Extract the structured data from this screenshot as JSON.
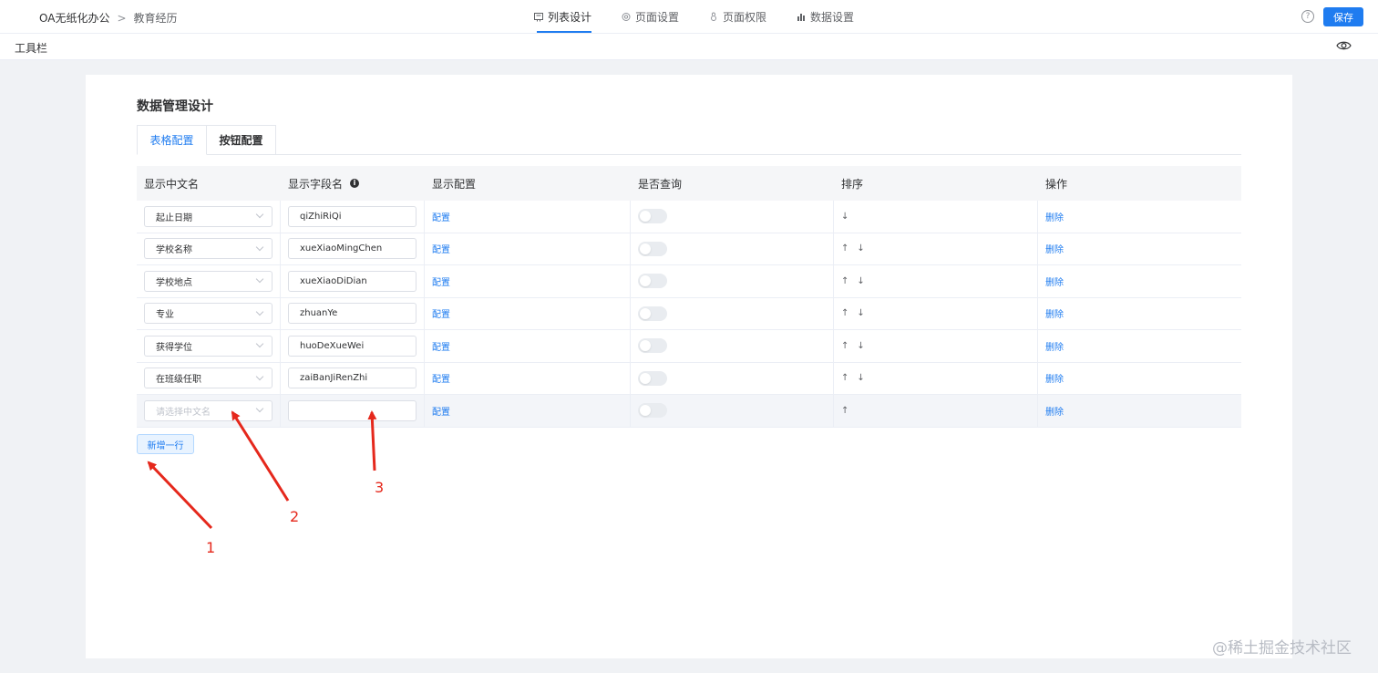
{
  "header": {
    "app_name": "OA无纸化办公",
    "breadcrumb_separator": ">",
    "current_page": "教育经历",
    "tabs": [
      {
        "label": "列表设计",
        "icon": "list-icon",
        "active": true
      },
      {
        "label": "页面设置",
        "icon": "gear-icon",
        "active": false
      },
      {
        "label": "页面权限",
        "icon": "lock-icon",
        "active": false
      },
      {
        "label": "数据设置",
        "icon": "bar-chart-icon",
        "active": false
      }
    ],
    "help_label": "?",
    "save_label": "保存"
  },
  "toolbar": {
    "title": "工具栏"
  },
  "main": {
    "title": "数据管理设计",
    "tabs": [
      {
        "label": "表格配置",
        "active": true
      },
      {
        "label": "按钮配置",
        "active": false
      }
    ],
    "table": {
      "columns": [
        "显示中文名",
        "显示字段名",
        "显示配置",
        "是否查询",
        "排序",
        "操作"
      ],
      "info_label": "i",
      "rows": [
        {
          "chinese_name": "起止日期",
          "field_name": "qiZhiRiQi",
          "config": "配置",
          "query": false,
          "sort_up": "",
          "sort_down": "↓",
          "action": "删除"
        },
        {
          "chinese_name": "学校名称",
          "field_name": "xueXiaoMingChen",
          "config": "配置",
          "query": false,
          "sort_up": "↑",
          "sort_down": "↓",
          "action": "删除"
        },
        {
          "chinese_name": "学校地点",
          "field_name": "xueXiaoDiDian",
          "config": "配置",
          "query": false,
          "sort_up": "↑",
          "sort_down": "↓",
          "action": "删除"
        },
        {
          "chinese_name": "专业",
          "field_name": "zhuanYe",
          "config": "配置",
          "query": false,
          "sort_up": "↑",
          "sort_down": "↓",
          "action": "删除"
        },
        {
          "chinese_name": "获得学位",
          "field_name": "huoDeXueWei",
          "config": "配置",
          "query": false,
          "sort_up": "↑",
          "sort_down": "↓",
          "action": "删除"
        },
        {
          "chinese_name": "在班级任职",
          "field_name": "zaiBanJiRenZhi",
          "config": "配置",
          "query": false,
          "sort_up": "↑",
          "sort_down": "↓",
          "action": "删除"
        },
        {
          "chinese_name": "",
          "chinese_placeholder": "请选择中文名",
          "field_name": "",
          "config": "配置",
          "query": false,
          "sort_up": "↑",
          "sort_down": "",
          "action": "删除"
        }
      ]
    },
    "add_row_label": "新增一行"
  },
  "annotations": [
    "1",
    "2",
    "3"
  ],
  "watermark": "@稀土掘金技术社区",
  "colors": {
    "accent": "#1f7cf0",
    "annotation": "#e5281c",
    "page_bg": "#f0f2f5"
  }
}
